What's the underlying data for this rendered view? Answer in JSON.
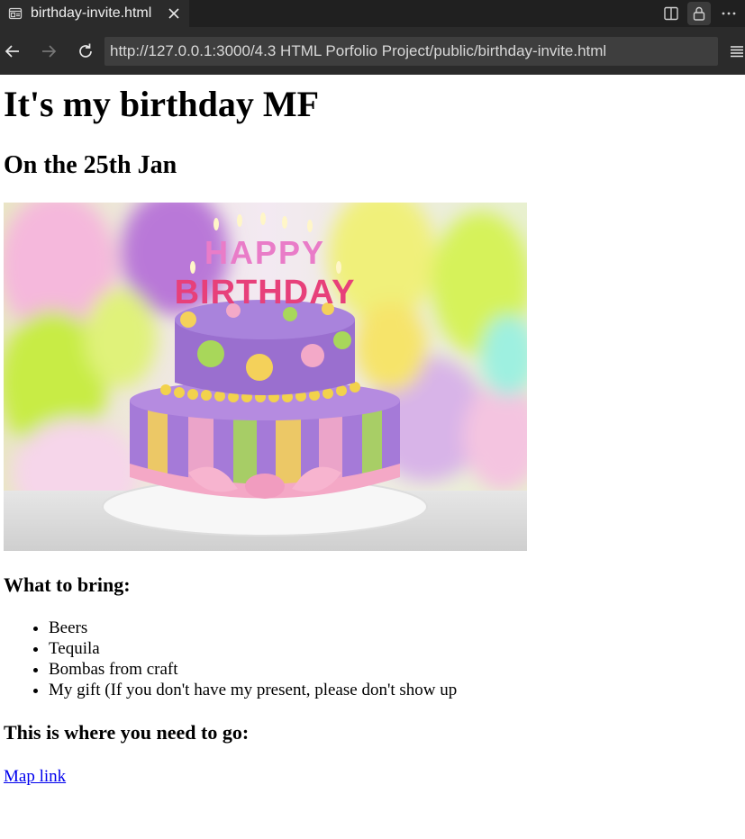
{
  "browser": {
    "tab_title": "birthday-invite.html",
    "url": "http://127.0.0.1:3000/4.3 HTML Porfolio Project/public/birthday-invite.html",
    "icons": [
      "page-icon",
      "close-icon",
      "split-view-icon",
      "lock-icon",
      "more-icon",
      "back-arrow-icon",
      "forward-arrow-icon",
      "reload-icon",
      "menu-icon"
    ]
  },
  "page": {
    "heading": "It's my birthday MF",
    "subheading": "On the 25th Jan",
    "bring_heading": "What to bring:",
    "bring_items": [
      "Beers",
      "Tequila",
      "Bombas from craft",
      "My gift (If you don't have my present, please don't show up"
    ],
    "go_heading": "This is where you need to go:",
    "map_link": "Map link",
    "cake_candles_text": "HAPPY BIRTHDAY"
  }
}
